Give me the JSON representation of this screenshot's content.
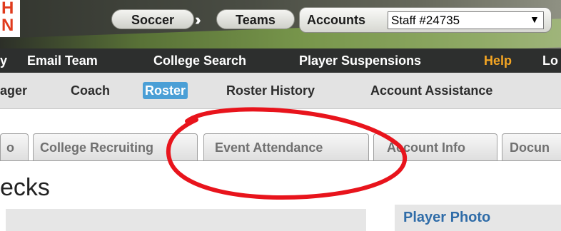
{
  "logo": {
    "line1": "H",
    "line2": "N"
  },
  "breadcrumb": {
    "sport": "Soccer",
    "separator": "››",
    "section": "Teams"
  },
  "accounts": {
    "label": "Accounts",
    "selected": "Staff #24735"
  },
  "main_nav": {
    "items": [
      {
        "label": "y"
      },
      {
        "label": "Email Team"
      },
      {
        "label": "College Search"
      },
      {
        "label": "Player Suspensions"
      },
      {
        "label": "Help"
      },
      {
        "label": "Lo"
      }
    ]
  },
  "sub_nav": {
    "items": [
      {
        "label": "ager"
      },
      {
        "label": "Coach"
      },
      {
        "label": "Roster"
      },
      {
        "label": "Roster History"
      },
      {
        "label": "Account Assistance"
      }
    ]
  },
  "tabs": {
    "items": [
      {
        "label": "o"
      },
      {
        "label": "College Recruiting"
      },
      {
        "label": "Event Attendance"
      },
      {
        "label": "Account Info"
      },
      {
        "label": "Docun"
      }
    ]
  },
  "page": {
    "title": "ecks",
    "player_photo_title": "Player Photo"
  },
  "colors": {
    "nav_bg": "#2d2f2e",
    "help": "#f5a623",
    "active_sub": "#4a9fd6",
    "annotation": "#e8141c",
    "panel_title": "#2f6ca8"
  }
}
